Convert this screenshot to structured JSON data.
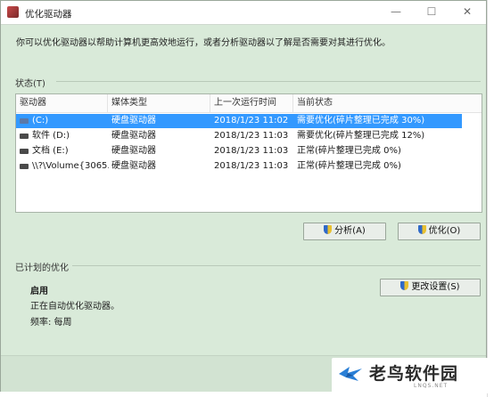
{
  "window": {
    "title": "优化驱动器",
    "minimize": "—",
    "maximize": "☐",
    "close": "✕"
  },
  "description": "你可以优化驱动器以帮助计算机更高效地运行，或者分析驱动器以了解是否需要对其进行优化。",
  "status_section": {
    "label": "状态(T)"
  },
  "table": {
    "columns": [
      "驱动器",
      "媒体类型",
      "上一次运行时间",
      "当前状态"
    ],
    "rows": [
      {
        "drive": "(C:)",
        "media": "硬盘驱动器",
        "last_run": "2018/1/23 11:02",
        "status": "需要优化(碎片整理已完成 30%)",
        "selected": true
      },
      {
        "drive": "软件 (D:)",
        "media": "硬盘驱动器",
        "last_run": "2018/1/23 11:03",
        "status": "需要优化(碎片整理已完成 12%)",
        "selected": false
      },
      {
        "drive": "文档 (E:)",
        "media": "硬盘驱动器",
        "last_run": "2018/1/23 11:03",
        "status": "正常(碎片整理已完成 0%)",
        "selected": false
      },
      {
        "drive": "\\\\?\\Volume{3065...",
        "media": "硬盘驱动器",
        "last_run": "2018/1/23 11:03",
        "status": "正常(碎片整理已完成 0%)",
        "selected": false
      }
    ]
  },
  "buttons": {
    "analyze": "分析(A)",
    "optimize": "优化(O)",
    "change_settings": "更改设置(S)"
  },
  "scheduled": {
    "section_label": "已计划的优化",
    "state": "启用",
    "detail": "正在自动优化驱动器。",
    "frequency": "频率: 每周"
  },
  "watermark": {
    "name": "老鸟软件园",
    "url": "LNQS.NET"
  },
  "colors": {
    "window_bg": "#d9ead9",
    "selection": "#3399ff"
  }
}
